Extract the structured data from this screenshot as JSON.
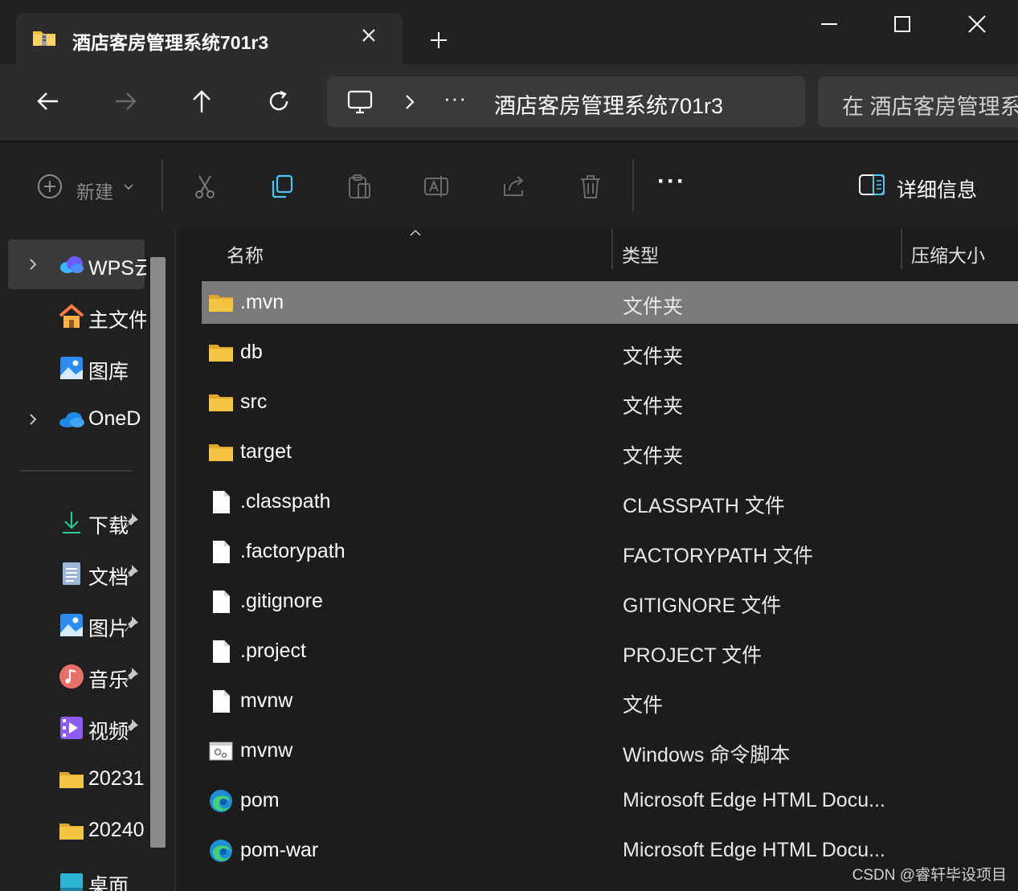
{
  "window": {
    "tab_title": "酒店客房管理系统701r3"
  },
  "address_bar": {
    "ellipsis": "···",
    "path": "酒店客房管理系统701r3",
    "search_placeholder": "在 酒店客房管理系"
  },
  "toolbar": {
    "new_label": "新建",
    "more_label": "···",
    "details_label": "详细信息"
  },
  "sidebar": {
    "items": [
      {
        "label": "WPS云",
        "icon": "cloud-icon"
      },
      {
        "label": "主文件",
        "icon": "home-icon"
      },
      {
        "label": "图库",
        "icon": "gallery-icon"
      },
      {
        "label": "OneD",
        "icon": "onedrive-icon"
      },
      {
        "label": "下载",
        "icon": "download-icon"
      },
      {
        "label": "文档",
        "icon": "document-icon"
      },
      {
        "label": "图片",
        "icon": "pictures-icon"
      },
      {
        "label": "音乐",
        "icon": "music-icon"
      },
      {
        "label": "视频",
        "icon": "video-icon"
      },
      {
        "label": "20231",
        "icon": "folder-icon"
      },
      {
        "label": "20240",
        "icon": "folder-icon"
      },
      {
        "label": "桌面",
        "icon": "desktop-icon"
      }
    ]
  },
  "columns": {
    "name": "名称",
    "type": "类型",
    "size": "压缩大小"
  },
  "files": [
    {
      "name": ".mvn",
      "type": "文件夹",
      "icon": "folder-icon"
    },
    {
      "name": "db",
      "type": "文件夹",
      "icon": "folder-icon"
    },
    {
      "name": "src",
      "type": "文件夹",
      "icon": "folder-icon"
    },
    {
      "name": "target",
      "type": "文件夹",
      "icon": "folder-icon"
    },
    {
      "name": ".classpath",
      "type": "CLASSPATH 文件",
      "icon": "file-icon"
    },
    {
      "name": ".factorypath",
      "type": "FACTORYPATH 文件",
      "icon": "file-icon"
    },
    {
      "name": ".gitignore",
      "type": "GITIGNORE 文件",
      "icon": "file-icon"
    },
    {
      "name": ".project",
      "type": "PROJECT 文件",
      "icon": "file-icon"
    },
    {
      "name": "mvnw",
      "type": "文件",
      "icon": "file-icon"
    },
    {
      "name": "mvnw",
      "type": "Windows 命令脚本",
      "icon": "script-icon"
    },
    {
      "name": "pom",
      "type": "Microsoft Edge HTML Docu...",
      "icon": "edge-icon"
    },
    {
      "name": "pom-war",
      "type": "Microsoft Edge HTML Docu...",
      "icon": "edge-icon"
    }
  ],
  "watermark": "CSDN @睿轩毕设项目",
  "colors": {
    "background": "#1c1c1c",
    "selected_row": "#7a7a7a",
    "folder": "#f4c542",
    "accent": "#4fc3f7"
  }
}
